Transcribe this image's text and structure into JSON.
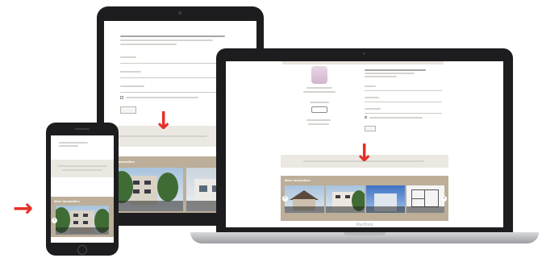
{
  "laptop": {
    "brand_label": "MacBook",
    "gallery_title": "Mehr Immobilien"
  },
  "tablet": {
    "gallery_title": "Mehr Immobilien"
  },
  "phone": {
    "gallery_title": "Mehr Immobilien"
  },
  "arrows": {
    "glyph_down": "↓",
    "glyph_right": "→"
  },
  "colors": {
    "arrow": "#e5302a",
    "gallery_band": "#bcae98",
    "device_frame": "#1d1d1f"
  }
}
